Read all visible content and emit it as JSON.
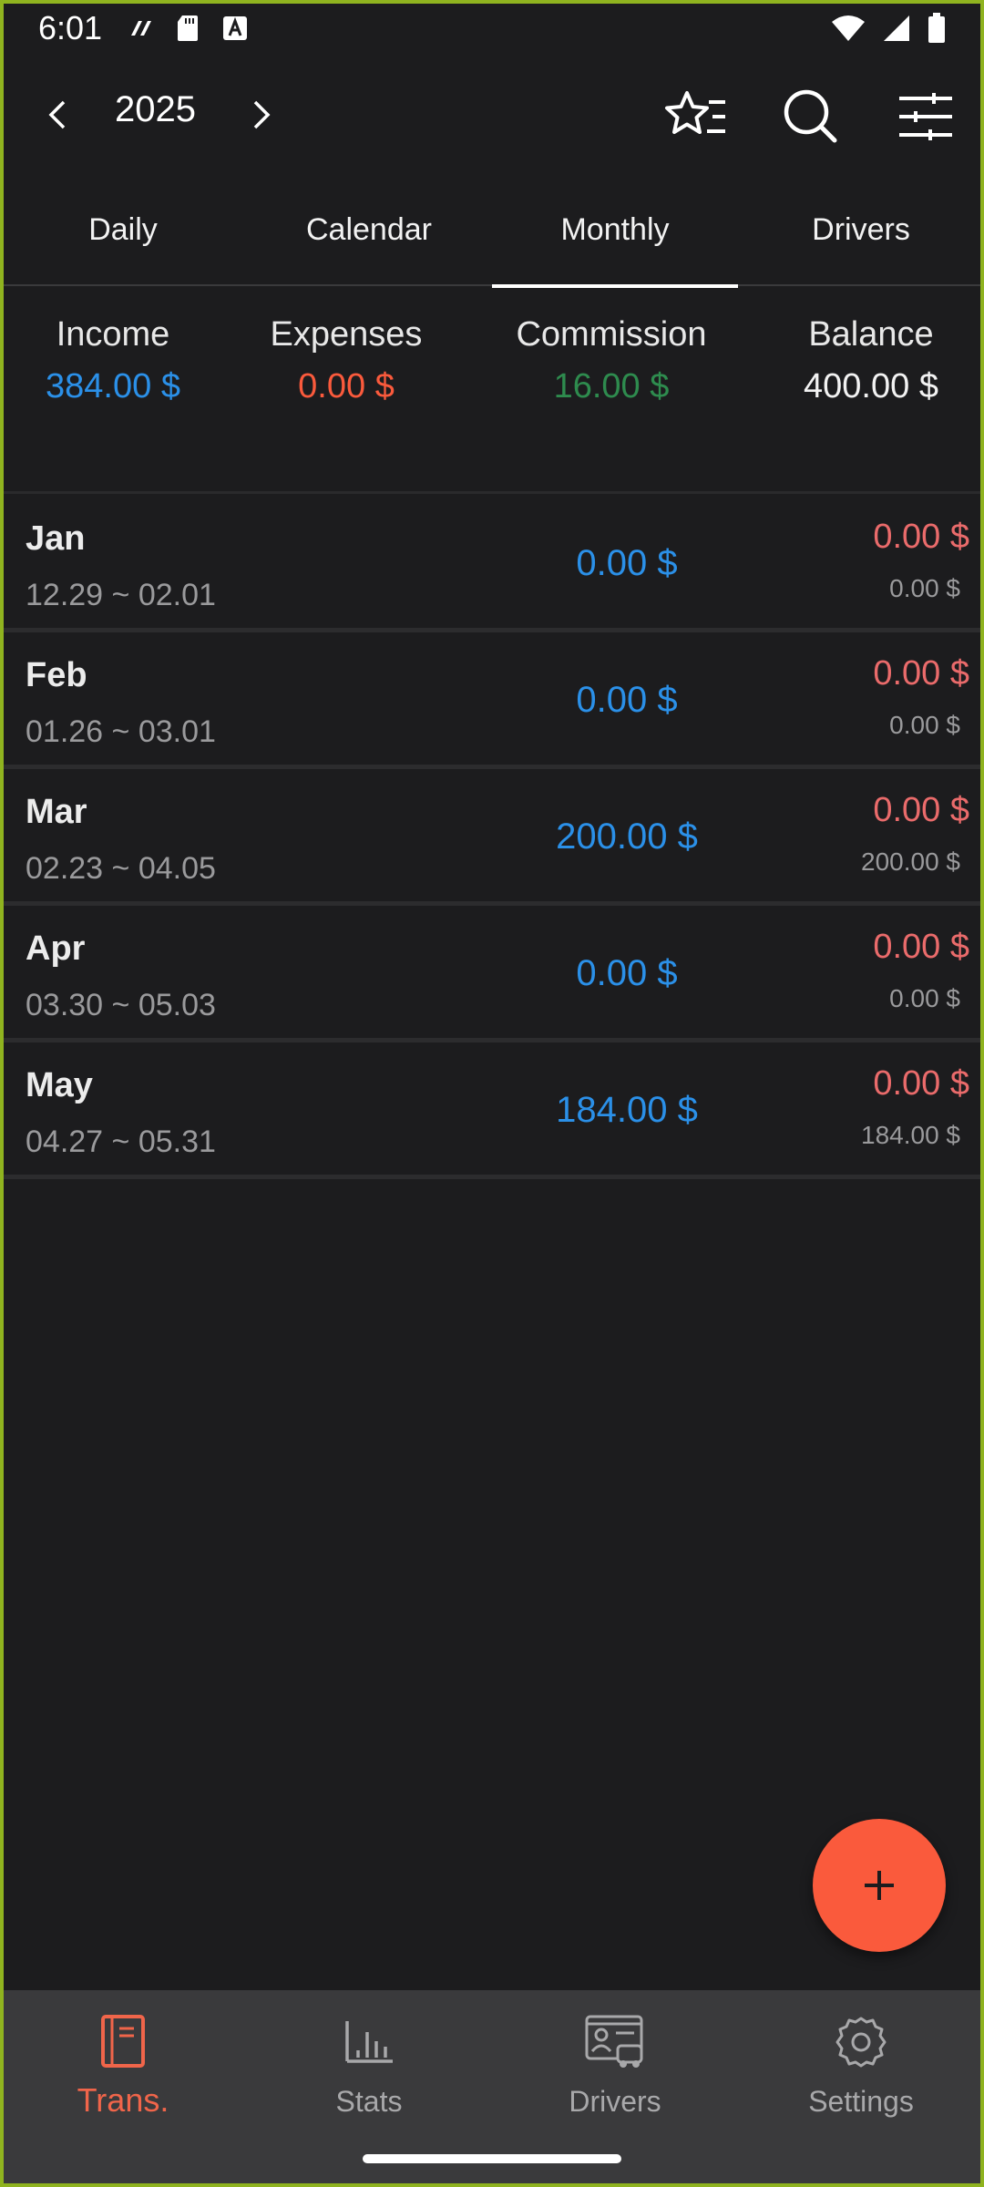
{
  "status_bar": {
    "time": "6:01",
    "left_icons": [
      "sync-icon",
      "sd-card-icon",
      "text-a-icon"
    ],
    "right_icons": [
      "wifi-icon",
      "cell-signal-icon",
      "battery-icon"
    ]
  },
  "header": {
    "year": "2025",
    "prev_icon": "chevron-left-icon",
    "next_icon": "chevron-right-icon",
    "actions": [
      "star-list-icon",
      "search-icon",
      "filter-sliders-icon"
    ]
  },
  "tabs": [
    {
      "label": "Daily",
      "active": false
    },
    {
      "label": "Calendar",
      "active": false
    },
    {
      "label": "Monthly",
      "active": true
    },
    {
      "label": "Drivers",
      "active": false
    }
  ],
  "summary": {
    "income": {
      "label": "Income",
      "value": "384.00 $"
    },
    "expenses": {
      "label": "Expenses",
      "value": "0.00 $"
    },
    "commission": {
      "label": "Commission",
      "value": "16.00 $"
    },
    "balance": {
      "label": "Balance",
      "value": "400.00 $"
    }
  },
  "months": [
    {
      "month": "Jan",
      "range": "12.29 ~ 02.01",
      "income": "0.00 $",
      "expense": "0.00 $",
      "sub": "0.00 $"
    },
    {
      "month": "Feb",
      "range": "01.26 ~ 03.01",
      "income": "0.00 $",
      "expense": "0.00 $",
      "sub": "0.00 $"
    },
    {
      "month": "Mar",
      "range": "02.23 ~ 04.05",
      "income": "200.00 $",
      "expense": "0.00 $",
      "sub": "200.00 $"
    },
    {
      "month": "Apr",
      "range": "03.30 ~ 05.03",
      "income": "0.00 $",
      "expense": "0.00 $",
      "sub": "0.00 $"
    },
    {
      "month": "May",
      "range": "04.27 ~ 05.31",
      "income": "184.00 $",
      "expense": "0.00 $",
      "sub": "184.00 $"
    }
  ],
  "fab": {
    "icon": "plus-icon"
  },
  "bottom_nav": [
    {
      "label": "Trans.",
      "icon": "book-icon",
      "active": true
    },
    {
      "label": "Stats",
      "icon": "bar-chart-icon",
      "active": false
    },
    {
      "label": "Drivers",
      "icon": "driver-card-icon",
      "active": false
    },
    {
      "label": "Settings",
      "icon": "gear-icon",
      "active": false
    }
  ],
  "colors": {
    "background": "#1c1c1e",
    "income": "#2b90e8",
    "expenses": "#fa5a3c",
    "commission": "#2e8b4e",
    "accent": "#f0654a",
    "nav_bg": "#3a3a3c"
  }
}
